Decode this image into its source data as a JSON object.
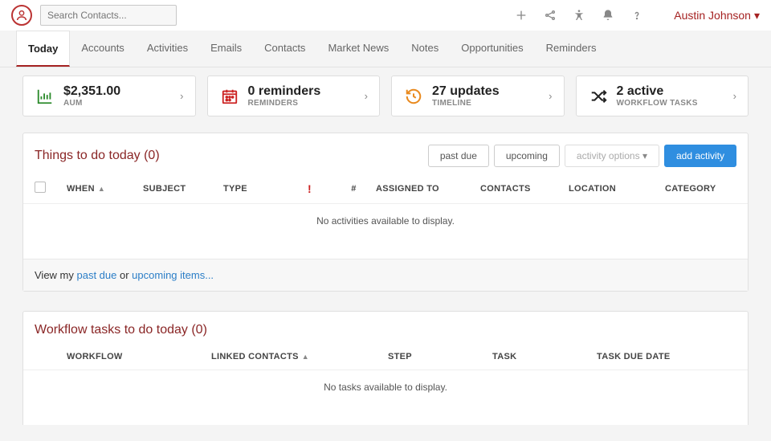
{
  "search": {
    "placeholder": "Search Contacts..."
  },
  "user": {
    "name": "Austin Johnson"
  },
  "tabs": [
    {
      "label": "Today"
    },
    {
      "label": "Accounts"
    },
    {
      "label": "Activities"
    },
    {
      "label": "Emails"
    },
    {
      "label": "Contacts"
    },
    {
      "label": "Market News"
    },
    {
      "label": "Notes"
    },
    {
      "label": "Opportunities"
    },
    {
      "label": "Reminders"
    }
  ],
  "stats": {
    "aum": {
      "value": "$2,351.00",
      "label": "AUM"
    },
    "reminders": {
      "value": "0 reminders",
      "label": "REMINDERS"
    },
    "timeline": {
      "value": "27 updates",
      "label": "TIMELINE"
    },
    "workflow": {
      "value": "2 active",
      "label": "WORKFLOW TASKS"
    }
  },
  "things": {
    "title": "Things to do today (0)",
    "buttons": {
      "past_due": "past due",
      "upcoming": "upcoming",
      "options": "activity options",
      "add": "add activity"
    },
    "columns": {
      "when": "WHEN",
      "subject": "SUBJECT",
      "type": "TYPE",
      "priority": "!",
      "count": "#",
      "assigned": "ASSIGNED TO",
      "contacts": "CONTACTS",
      "location": "LOCATION",
      "category": "CATEGORY"
    },
    "empty": "No activities available to display.",
    "footer_prefix": "View my ",
    "footer_pastdue": "past due",
    "footer_or": " or ",
    "footer_upcoming": "upcoming items..."
  },
  "workflow_panel": {
    "title": "Workflow tasks to do today (0)",
    "columns": {
      "workflow": "WORKFLOW",
      "linked": "LINKED CONTACTS",
      "step": "STEP",
      "task": "TASK",
      "due": "TASK DUE DATE"
    },
    "empty": "No tasks available to display."
  }
}
